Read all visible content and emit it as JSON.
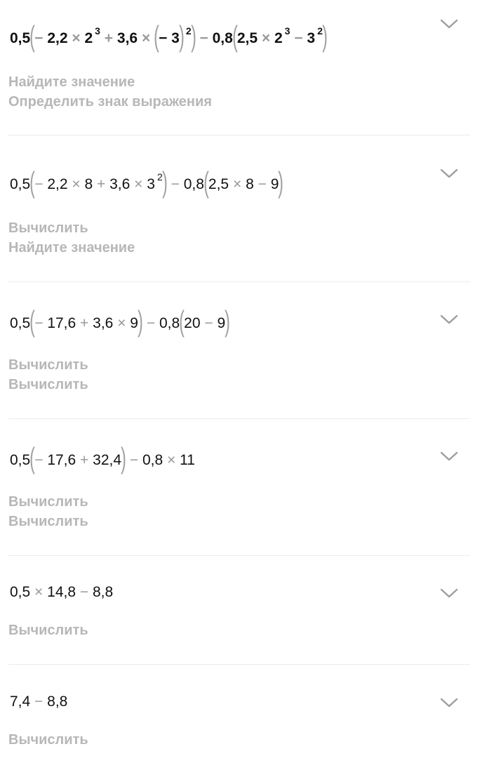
{
  "steps": [
    {
      "bold": true,
      "parts": [
        "0,5",
        "−",
        "2,2",
        "×",
        "2",
        "3",
        "+",
        "3,6",
        "×",
        "−",
        "3",
        "2",
        "−",
        "0,8",
        "2,5",
        "×",
        "2",
        "3",
        "−",
        "3",
        "2"
      ],
      "hints": [
        "Найдите значение",
        "Определить знак выражения"
      ],
      "chevron_icon": "chevron-down-icon"
    },
    {
      "bold": false,
      "parts": [
        "0,5",
        "−",
        "2,2",
        "×",
        "8",
        "+",
        "3,6",
        "×",
        "3",
        "2",
        "−",
        "0,8",
        "2,5",
        "×",
        "8",
        "−",
        "9"
      ],
      "hints": [
        "Вычислить",
        "Найдите значение"
      ],
      "chevron_icon": "chevron-down-icon"
    },
    {
      "bold": false,
      "parts": [
        "0,5",
        "−",
        "17,6",
        "+",
        "3,6",
        "×",
        "9",
        "−",
        "0,8",
        "20",
        "−",
        "9"
      ],
      "hints": [
        "Вычислить",
        "Вычислить"
      ],
      "chevron_icon": "chevron-down-icon"
    },
    {
      "bold": false,
      "parts": [
        "0,5",
        "−",
        "17,6",
        "+",
        "32,4",
        "−",
        "0,8",
        "×",
        "11"
      ],
      "hints": [
        "Вычислить",
        "Вычислить"
      ],
      "chevron_icon": "chevron-down-icon"
    },
    {
      "bold": false,
      "parts": [
        "0,5",
        "×",
        "14,8",
        "−",
        "8,8"
      ],
      "hints": [
        "Вычислить"
      ],
      "chevron_icon": "chevron-down-icon"
    },
    {
      "bold": false,
      "parts": [
        "7,4",
        "−",
        "8,8"
      ],
      "hints": [
        "Вычислить"
      ],
      "chevron_icon": "chevron-down-icon"
    }
  ],
  "colors": {
    "text": "#111111",
    "operator": "#9a9a9a",
    "hint": "#b7b7b7",
    "divider": "#ececec",
    "chevron": "#9e9e9e"
  }
}
